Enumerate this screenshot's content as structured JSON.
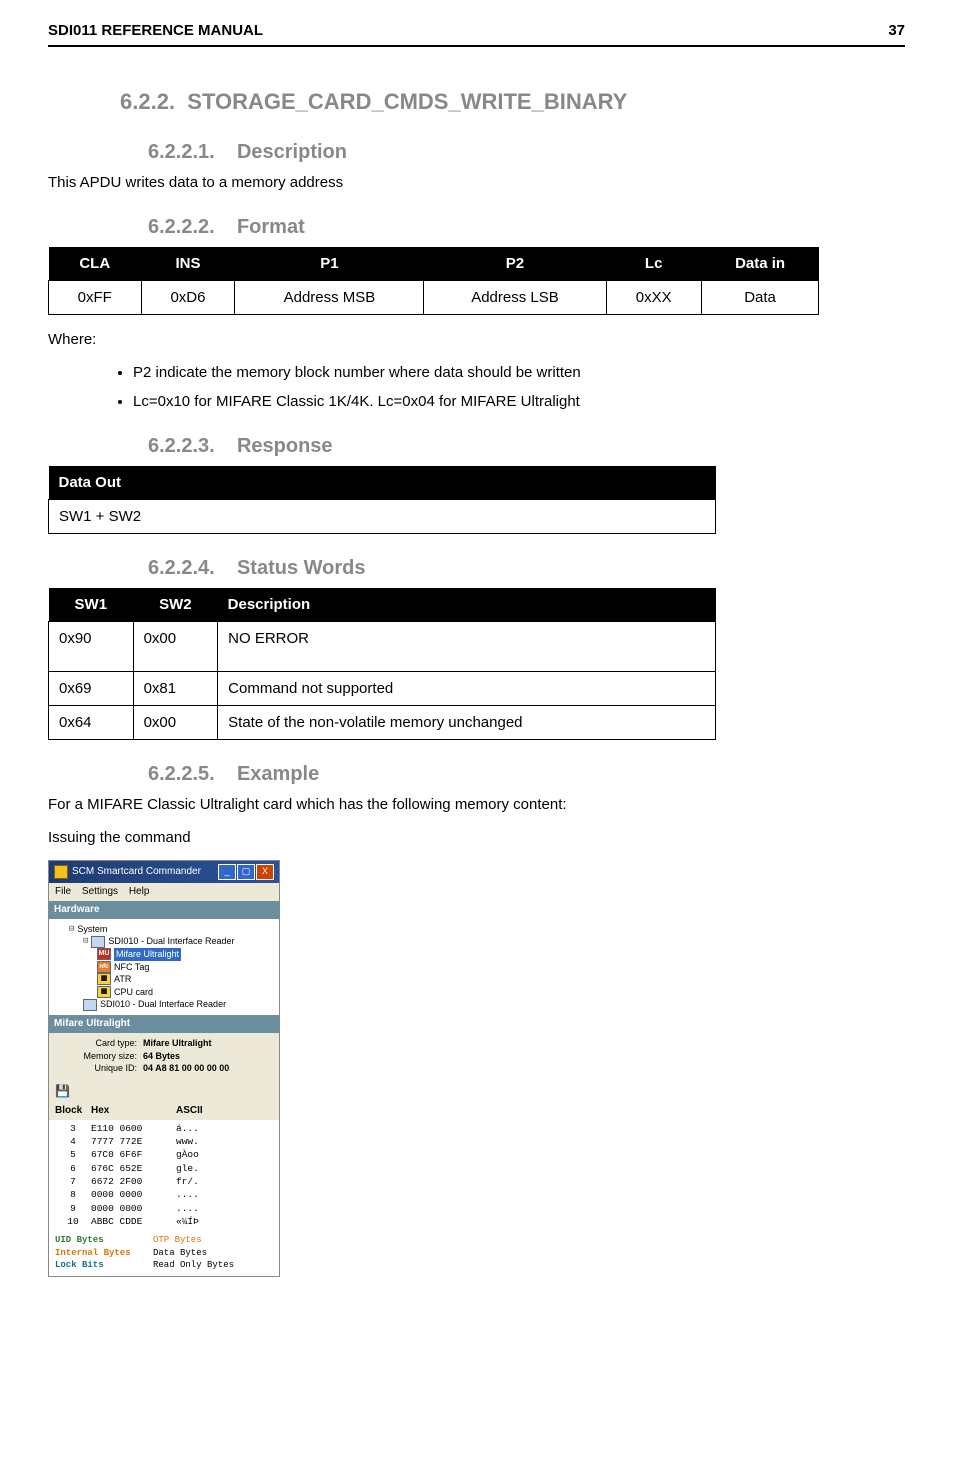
{
  "header": {
    "title": "SDI011 REFERENCE MANUAL",
    "page_number": "37"
  },
  "section": {
    "number": "6.2.2.",
    "title": "STORAGE_CARD_CMDS_WRITE_BINARY",
    "sub": {
      "s1": {
        "number": "6.2.2.1.",
        "title": "Description",
        "text": "This APDU writes data to a memory address"
      },
      "s2": {
        "number": "6.2.2.2.",
        "title": "Format"
      },
      "s3": {
        "number": "6.2.2.3.",
        "title": "Response"
      },
      "s4": {
        "number": "6.2.2.4.",
        "title": "Status Words"
      },
      "s5": {
        "number": "6.2.2.5.",
        "title": "Example"
      }
    }
  },
  "format_table": {
    "headers": [
      "CLA",
      "INS",
      "P1",
      "P2",
      "Lc",
      "Data in"
    ],
    "row": [
      "0xFF",
      "0xD6",
      "Address MSB",
      "Address LSB",
      "0xXX",
      "Data"
    ]
  },
  "where_label": "Where:",
  "bullets": [
    "P2 indicate the memory block number where data should be written",
    "Lc=0x10 for MIFARE Classic 1K/4K. Lc=0x04 for MIFARE Ultralight"
  ],
  "response_table": {
    "header": "Data Out",
    "row": "SW1 + SW2"
  },
  "status_table": {
    "headers": [
      "SW1",
      "SW2",
      "Description"
    ],
    "rows": [
      {
        "sw1": "0x90",
        "sw2": "0x00",
        "desc": "NO ERROR"
      },
      {
        "sw1": "0x69",
        "sw2": "0x81",
        "desc": "Command not supported"
      },
      {
        "sw1": "0x64",
        "sw2": "0x00",
        "desc": "State of the non-volatile memory unchanged"
      }
    ]
  },
  "example": {
    "text1": "For a MIFARE Classic Ultralight card which has the following memory content:",
    "text2": "Issuing the command"
  },
  "app": {
    "title": "SCM Smartcard Commander",
    "menu": [
      "File",
      "Settings",
      "Help"
    ],
    "hardware_label": "Hardware",
    "tree": {
      "root": "System",
      "reader1": "SDI010 - Dual Interface Reader",
      "items": [
        "Mifare Ultralight",
        "NFC Tag",
        "ATR",
        "CPU card"
      ],
      "reader2": "SDI010 - Dual Interface Reader"
    },
    "mifare_label": "Mifare Ultralight",
    "info": {
      "card_type_label": "Card type:",
      "card_type": "Mifare Ultralight",
      "mem_label": "Memory size:",
      "mem": "64 Bytes",
      "uid_label": "Unique ID:",
      "uid": "04 A8 81 00 00 00 00"
    },
    "hex_headers": [
      "Block",
      "Hex",
      "ASCII"
    ],
    "hex_rows": [
      {
        "b": "3",
        "hex": "E110 0600",
        "ascii": "á..."
      },
      {
        "b": "4",
        "hex": "7777 772E",
        "ascii": "www."
      },
      {
        "b": "5",
        "hex": "67C0 6F6F",
        "ascii": "gÀoo"
      },
      {
        "b": "6",
        "hex": "676C 652E",
        "ascii": "gle."
      },
      {
        "b": "7",
        "hex": "6672 2F00",
        "ascii": "fr/."
      },
      {
        "b": "8",
        "hex": "0000 0000",
        "ascii": "...."
      },
      {
        "b": "9",
        "hex": "0000 0000",
        "ascii": "...."
      },
      {
        "b": "10",
        "hex": "ABBC CDDE",
        "ascii": "«¼ÍÞ"
      }
    ],
    "legend": [
      {
        "k": "UID Bytes",
        "v": "OTP Bytes"
      },
      {
        "k": "Internal Bytes",
        "v": "Data Bytes"
      },
      {
        "k": "Lock Bits",
        "v": "Read Only Bytes"
      }
    ]
  }
}
